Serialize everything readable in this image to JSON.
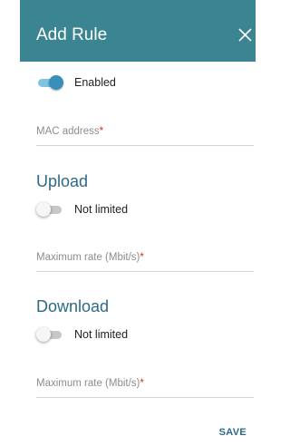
{
  "dialog": {
    "title": "Add Rule"
  },
  "enabled_toggle": {
    "label": "Enabled",
    "on": true
  },
  "mac_field": {
    "label": "MAC address",
    "required_mark": "*",
    "value": ""
  },
  "upload": {
    "heading": "Upload",
    "limit_toggle": {
      "label": "Not limited",
      "on": false
    },
    "rate_field": {
      "label": "Maximum rate (Mbit/s)",
      "required_mark": "*",
      "value": ""
    }
  },
  "download": {
    "heading": "Download",
    "limit_toggle": {
      "label": "Not limited",
      "on": false
    },
    "rate_field": {
      "label": "Maximum rate (Mbit/s)",
      "required_mark": "*",
      "value": ""
    }
  },
  "actions": {
    "save_label": "SAVE"
  },
  "icons": {
    "close": "close-icon"
  },
  "colors": {
    "header": "#3b8592",
    "accent": "#2d6a87",
    "required": "#e0281c",
    "toggle_on": "#3a8fb8"
  }
}
